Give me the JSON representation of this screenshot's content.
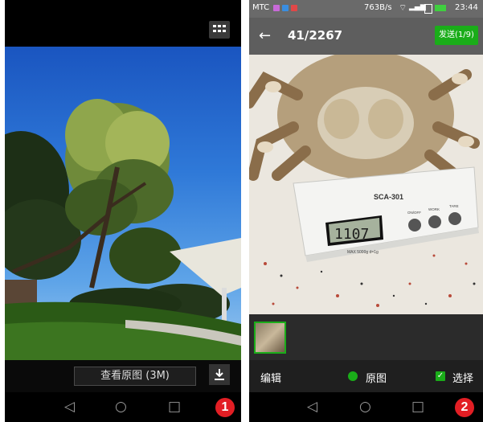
{
  "phone1": {
    "view_original_label": "查看原图 (3M)",
    "download_icon": "download-icon",
    "menu_icon": "grid-menu-icon",
    "badge": "1"
  },
  "phone2": {
    "status": {
      "carrier": "MTC",
      "speed": "763B/s",
      "time": "23:44"
    },
    "counter": "41/2267",
    "send_label": "发送(1/9)",
    "edit_label": "编辑",
    "original_label": "原图",
    "select_label": "选择",
    "badge": "2",
    "scale": {
      "model": "SCA-301",
      "display": "1107",
      "btn1": "ON/OFF",
      "btn2": "WORK",
      "btn3": "TARE",
      "max_label": "MAX 5000g  d=1g"
    }
  },
  "nav": {
    "back_glyph": "◁",
    "home_glyph": "○",
    "recent_glyph": "□"
  },
  "colors": {
    "accent_green": "#1aad19",
    "badge_red": "#e21e24"
  }
}
